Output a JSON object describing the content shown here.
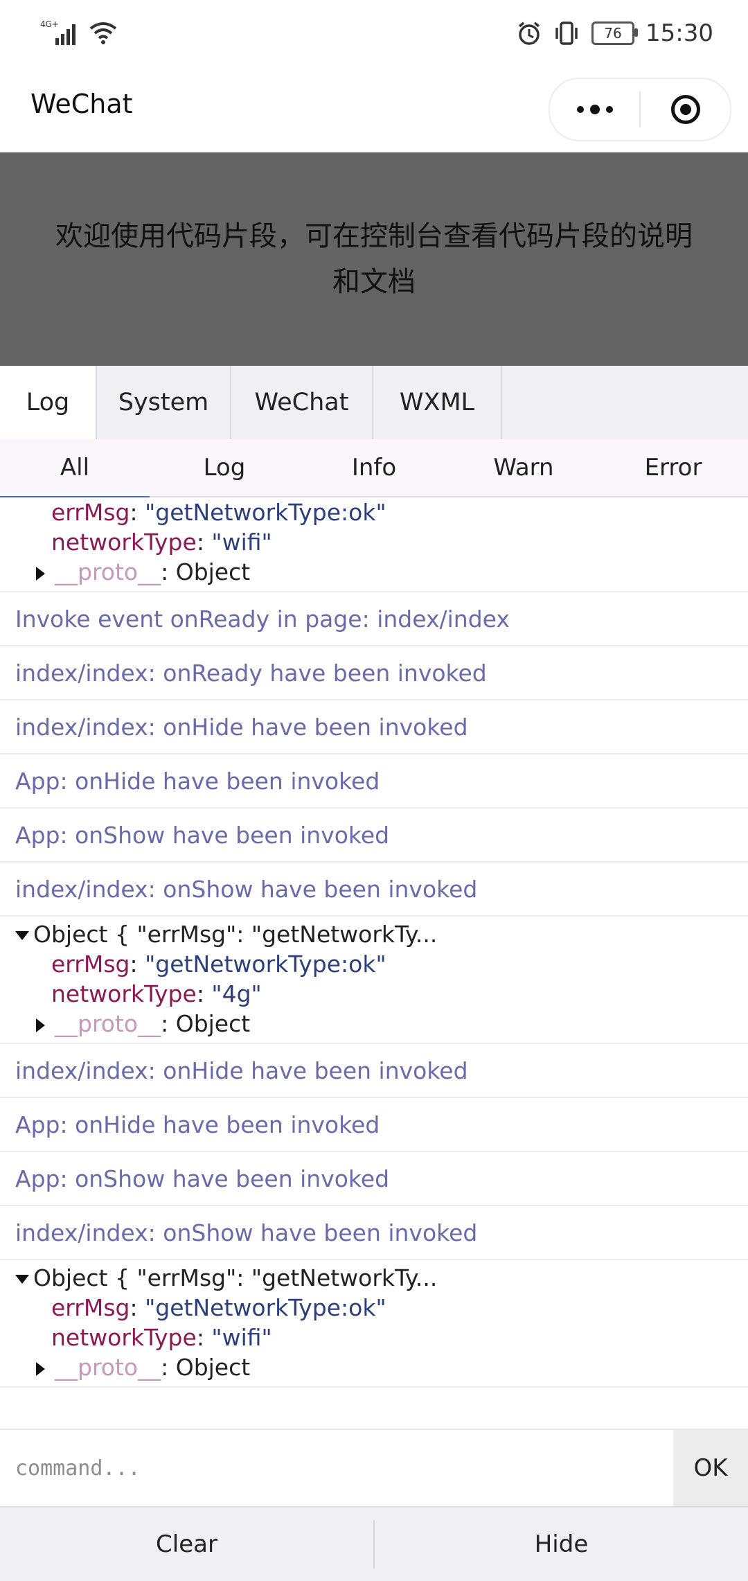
{
  "status_bar": {
    "network": "4G+",
    "battery": "76",
    "time": "15:30",
    "icons": [
      "signal-icon",
      "wifi-icon",
      "alarm-icon",
      "vibrate-icon",
      "battery-icon"
    ]
  },
  "header": {
    "title": "WeChat",
    "more_icon": "more-dots-icon",
    "close_icon": "target-icon"
  },
  "banner": {
    "text": "欢迎使用代码片段，可在控制台查看代码片段的说明和文档"
  },
  "tabs": [
    {
      "label": "Log",
      "active": true
    },
    {
      "label": "System",
      "active": false
    },
    {
      "label": "WeChat",
      "active": false
    },
    {
      "label": "WXML",
      "active": false
    }
  ],
  "filters": [
    {
      "label": "All",
      "active": true
    },
    {
      "label": "Log",
      "active": false
    },
    {
      "label": "Info",
      "active": false
    },
    {
      "label": "Warn",
      "active": false
    },
    {
      "label": "Error",
      "active": false
    }
  ],
  "log": {
    "top_partial": {
      "errMsg_key": "errMsg",
      "errMsg_val": "\"getNetworkType:ok\"",
      "network_key": "networkType",
      "network_val": "\"wifi\"",
      "proto_key": "__proto__",
      "proto_val": ": Object"
    },
    "messages_a": [
      "Invoke event onReady in page: index/index",
      "index/index: onReady have been invoked",
      "index/index: onHide have been invoked",
      "App: onHide have been invoked",
      "App: onShow have been invoked",
      "index/index: onShow have been invoked"
    ],
    "object_1": {
      "head": "Object { \"errMsg\": \"getNetworkTy...",
      "errMsg_key": "errMsg",
      "errMsg_val": "\"getNetworkType:ok\"",
      "network_key": "networkType",
      "network_val": "\"4g\"",
      "proto_key": "__proto__",
      "proto_val": ": Object"
    },
    "messages_b": [
      "index/index: onHide have been invoked",
      "App: onHide have been invoked",
      "App: onShow have been invoked",
      "index/index: onShow have been invoked"
    ],
    "object_2": {
      "head": "Object { \"errMsg\": \"getNetworkTy...",
      "errMsg_key": "errMsg",
      "errMsg_val": "\"getNetworkType:ok\"",
      "network_key": "networkType",
      "network_val": "\"wifi\"",
      "proto_key": "__proto__",
      "proto_val": ": Object"
    }
  },
  "command": {
    "placeholder": "command...",
    "ok_label": "OK"
  },
  "bottom": {
    "clear_label": "Clear",
    "hide_label": "Hide"
  }
}
